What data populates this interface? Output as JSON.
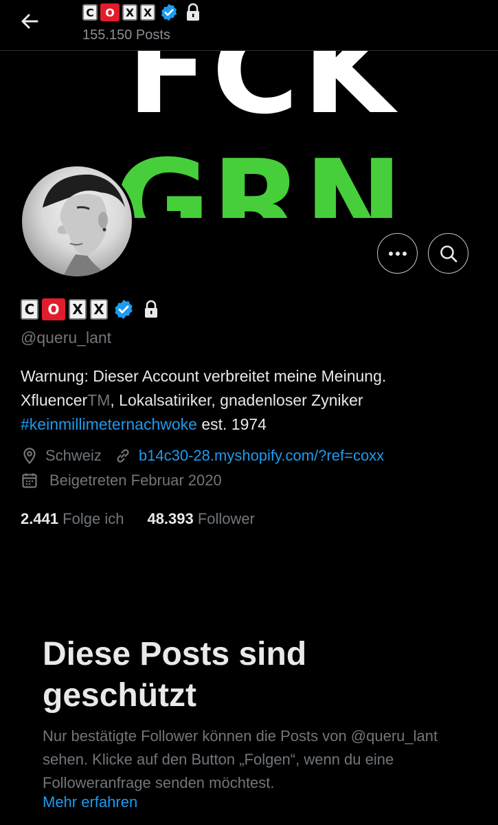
{
  "header": {
    "name_tiles": [
      "C",
      "O",
      "X",
      "X"
    ],
    "post_count": "155.150 Posts"
  },
  "banner": {
    "line1": "FCK",
    "line2": "GRN"
  },
  "profile": {
    "name_tiles": [
      "C",
      "O",
      "X",
      "X"
    ],
    "handle": "@queru_lant",
    "bio_line1": "Warnung: Dieser Account verbreitet meine Meinung.",
    "bio_line2_a": "Xfluencer",
    "bio_line2_tm": "TM",
    "bio_line2_b": ", Lokalsatiriker, gnadenloser Zyniker",
    "bio_hashtag": "#keinmillimeternachwoke",
    "bio_line3_rest": " est. 1974",
    "location": "Schweiz",
    "website": "b14c30-28.myshopify.com/?ref=coxx",
    "joined": "Beigetreten Februar 2020",
    "following_count": "2.441",
    "following_label": " Folge ich",
    "followers_count": "48.393",
    "followers_label": " Follower"
  },
  "protected": {
    "title": "Diese Posts sind geschützt",
    "description": "Nur bestätigte Follower können die Posts von @queru_lant sehen. Klicke auf den Button „Folgen“, wenn du eine Followeranfrage senden möchtest.",
    "learn_more": "Mehr erfahren"
  },
  "colors": {
    "background": "#000000",
    "accent_blue": "#1d9bf0",
    "muted_gray": "#71767b",
    "banner_green": "#46cf3a",
    "tile_red": "#e11d2c"
  },
  "icons": [
    "back-arrow-icon",
    "verified-badge-icon",
    "lock-icon",
    "more-icon",
    "search-icon",
    "location-pin-icon",
    "link-icon",
    "calendar-icon"
  ]
}
